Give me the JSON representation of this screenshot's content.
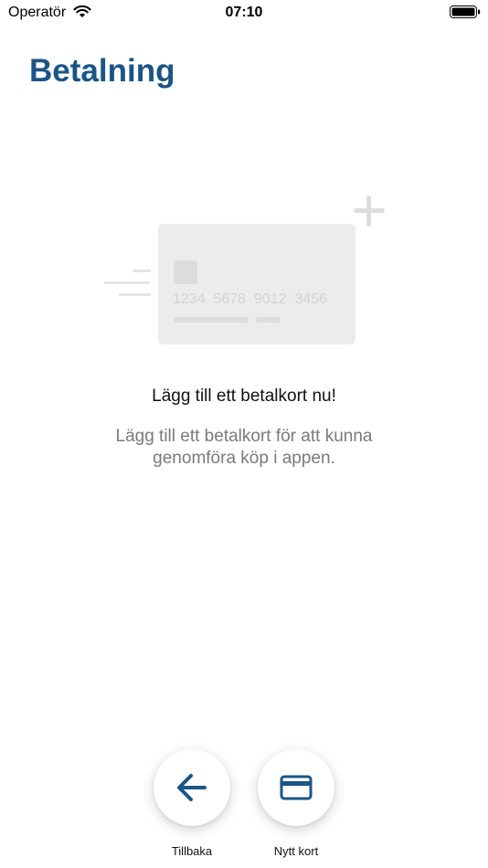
{
  "status_bar": {
    "carrier": "Operatör",
    "time": "07:10",
    "icons": [
      "wifi-icon",
      "battery-icon"
    ]
  },
  "header": {
    "title": "Betalning"
  },
  "illustration": {
    "card_number": "1234  5678  9012  3456",
    "icons": [
      "credit-card-illustration",
      "plus-icon",
      "speed-lines"
    ]
  },
  "empty_state": {
    "heading": "Lägg till ett betalkort nu!",
    "description": "Lägg till ett betalkort för att kunna genomföra köp i appen."
  },
  "actions": {
    "back": {
      "label": "Tillbaka",
      "icon": "arrow-left-icon"
    },
    "new_card": {
      "label": "Nytt kort",
      "icon": "credit-card-icon"
    }
  },
  "colors": {
    "accent": "#1b5586",
    "muted_text": "#7a7a7a",
    "illustration_fill": "#ececec"
  }
}
